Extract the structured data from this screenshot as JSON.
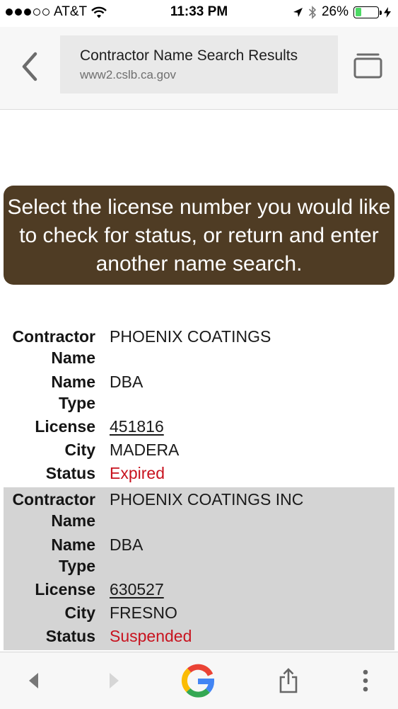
{
  "status_bar": {
    "carrier": "AT&T",
    "time": "11:33 PM",
    "battery_percent": "26%",
    "battery_level": 0.26,
    "battery_color": "#4cd964"
  },
  "browser": {
    "page_title": "Contractor Name Search Results",
    "host": "www2.cslb.ca.gov",
    "icons": [
      "back-chevron",
      "tab-switcher",
      "back-arrow",
      "forward-arrow",
      "google-logo",
      "share",
      "more-vertical"
    ]
  },
  "banner": {
    "text": "Select the license number you would like to check for status, or return and enter another name search.",
    "bg_color": "#4f3c24"
  },
  "labels": {
    "contractor_name_1": "Contractor",
    "contractor_name_2": "Name",
    "name_type_1": "Name",
    "name_type_2": "Type",
    "license": "License",
    "city": "City",
    "status": "Status"
  },
  "results": [
    {
      "contractor_name": "PHOENIX COATINGS",
      "name_type": "DBA",
      "license": "451816",
      "city": "MADERA",
      "status": "Expired"
    },
    {
      "contractor_name": "PHOENIX COATINGS INC",
      "name_type": "DBA",
      "license": "630527",
      "city": "FRESNO",
      "status": "Suspended"
    }
  ],
  "colors": {
    "status_text": "#c8131f",
    "alt_row": "#d4d4d4"
  }
}
